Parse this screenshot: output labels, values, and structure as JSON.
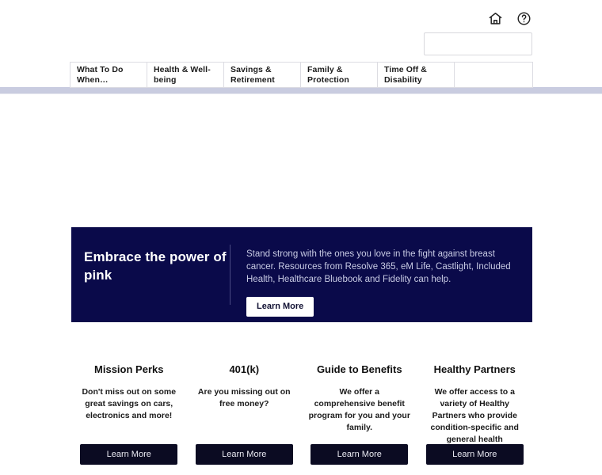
{
  "header": {
    "home_icon": "home-icon",
    "help_icon": "help-circle-icon",
    "search": {
      "value": "",
      "placeholder": ""
    }
  },
  "nav": {
    "tabs": [
      {
        "label": "What To Do When…"
      },
      {
        "label": "Health & Well-being"
      },
      {
        "label": "Savings & Retirement"
      },
      {
        "label": "Family & Protection"
      },
      {
        "label": "Time Off & Disability"
      },
      {
        "label": ""
      }
    ],
    "accent_color": "#c9cce0"
  },
  "hero": {
    "title": "Embrace the power of pink",
    "body": "Stand strong with the ones you love in the fight against breast cancer. Resources from Resolve 365, eM Life, Castlight, Included Health, Healthcare Bluebook and Fidelity can help.",
    "button_label": "Learn More",
    "background_color": "#0a0a4a"
  },
  "cards": [
    {
      "title": "Mission Perks",
      "description": "Don't miss out on some great savings on cars, electronics and more!",
      "button_label": "Learn More"
    },
    {
      "title": "401(k)",
      "description": "Are you missing out on free money?",
      "button_label": "Learn More"
    },
    {
      "title": "Guide to Benefits",
      "description": "We offer a comprehensive benefit program for you and your family.",
      "button_label": "Learn More"
    },
    {
      "title": "Healthy Partners",
      "description": "We offer access to a variety of Healthy Partners who provide condition-specific and general health assistance.",
      "button_label": "Learn More"
    }
  ]
}
